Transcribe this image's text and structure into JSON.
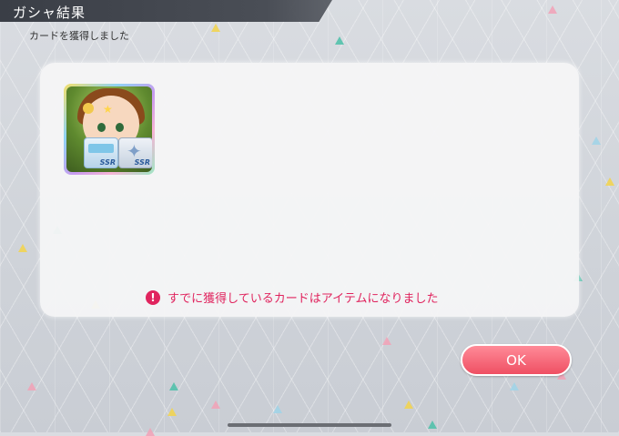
{
  "header": {
    "title": "ガシャ結果"
  },
  "subtitle": "カードを獲得しました",
  "card": {
    "badges": [
      "SSR",
      "SSR"
    ]
  },
  "notice": {
    "text": "すでに獲得しているカードはアイテムになりました"
  },
  "buttons": {
    "ok_label": "OK"
  },
  "colors": {
    "accent": "#ef4f63",
    "notice": "#e0245e",
    "header": "#3a3e46"
  },
  "icons": {
    "notice": "exclamation-circle-icon",
    "star": "star-icon",
    "ticket": "ticket-icon"
  }
}
